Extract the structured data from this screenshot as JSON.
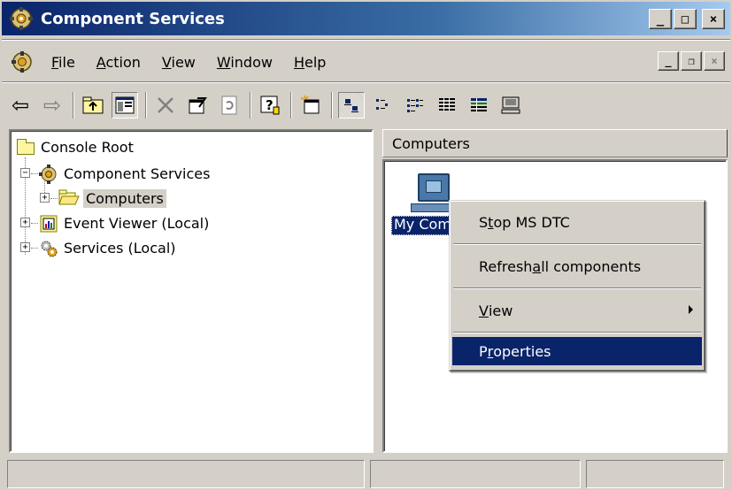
{
  "window": {
    "title": "Component Services",
    "buttons": [
      "_",
      "□",
      "×"
    ]
  },
  "menubar": {
    "items": [
      {
        "label": "File",
        "accel": "F",
        "rest": "ile"
      },
      {
        "label": "Action",
        "accel": "A",
        "rest": "ction"
      },
      {
        "label": "View",
        "accel": "V",
        "rest": "iew"
      },
      {
        "label": "Window",
        "accel": "W",
        "rest": "indow"
      },
      {
        "label": "Help",
        "accel": "H",
        "rest": "elp"
      }
    ],
    "mdi_buttons": [
      "_",
      "❐",
      "×"
    ]
  },
  "toolbar": {
    "icons": [
      "back-arrow-icon",
      "forward-arrow-icon",
      "up-folder-icon",
      "show-tree-icon",
      "delete-icon",
      "properties-icon",
      "refresh-icon",
      "help-icon",
      "new-window-icon",
      "large-icons-icon",
      "small-icons-icon",
      "list-icon",
      "details-icon",
      "detail-grid-icon",
      "computer-config-icon"
    ]
  },
  "tree": {
    "items": [
      {
        "label": "Console Root"
      },
      {
        "label": "Component Services"
      },
      {
        "label": "Computers"
      },
      {
        "label": "Event Viewer (Local)"
      },
      {
        "label": "Services (Local)"
      }
    ]
  },
  "right_pane": {
    "header": "Computers",
    "item_label": "My Computer"
  },
  "context_menu": {
    "items": [
      {
        "label": "Stop MS DTC",
        "pre": "S",
        "accel": "t",
        "post": "op MS DTC"
      },
      {
        "label": "Refresh all components",
        "pre": "Refresh ",
        "accel": "a",
        "post": "ll components"
      },
      {
        "label": "View",
        "pre": "",
        "accel": "V",
        "post": "iew"
      },
      {
        "label": "Properties",
        "pre": "P",
        "accel": "r",
        "post": "operties"
      }
    ]
  },
  "colors": {
    "title_bar": "#0a246a",
    "highlight": "#0a246a",
    "face": "#d4d0c8"
  }
}
